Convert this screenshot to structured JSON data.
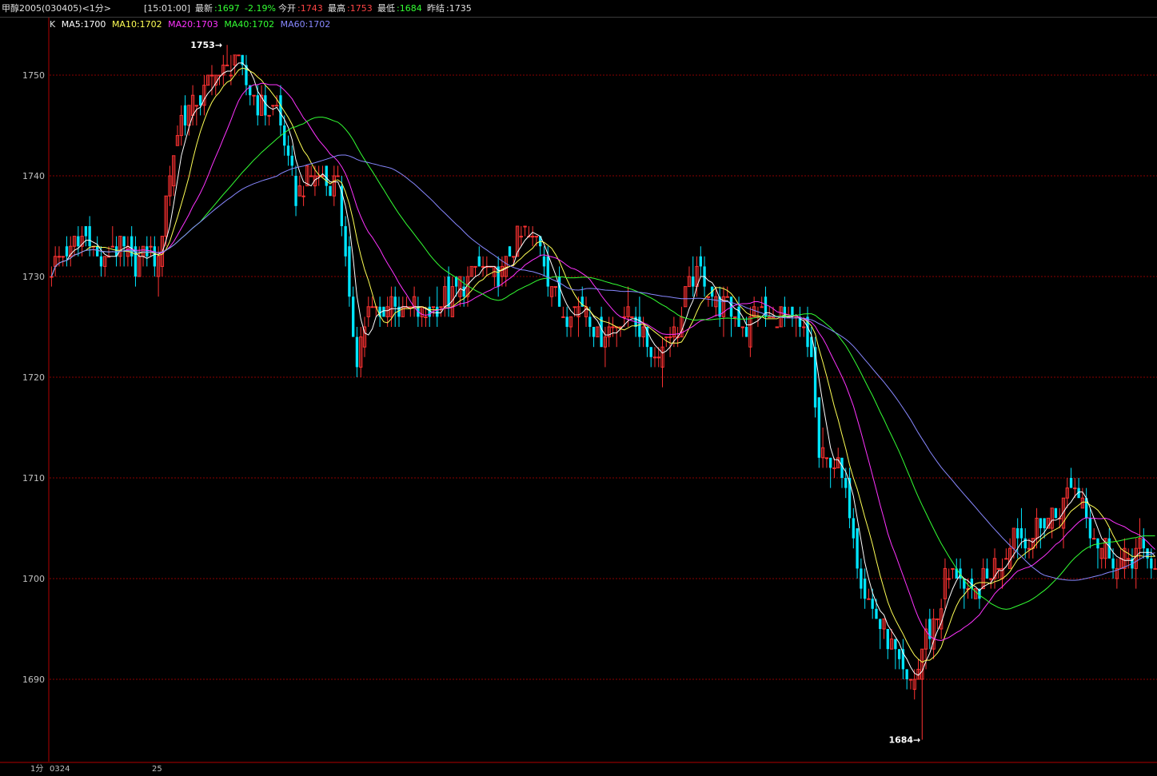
{
  "header": {
    "instrument": "甲醇2005(030405)<1分>",
    "time": "[15:01:00]",
    "latest_label": "最新",
    "latest_value": ":1697",
    "change_pct": "-2.19%",
    "open_label": "今开",
    "open_value": ":1743",
    "high_label": "最高",
    "high_value": ":1753",
    "low_label": "最低",
    "low_value": ":1684",
    "prev_close_label": "昨结",
    "prev_close_value": ":1735"
  },
  "legend": {
    "k": "K",
    "items": [
      {
        "text": "MA5:1700",
        "color": "#ffffff"
      },
      {
        "text": "MA10:1702",
        "color": "#ffff55"
      },
      {
        "text": "MA20:1703",
        "color": "#ff33ff"
      },
      {
        "text": "MA40:1702",
        "color": "#33ff33"
      },
      {
        "text": "MA60:1702",
        "color": "#8888ff"
      }
    ]
  },
  "footer": {
    "period": "1分",
    "date1": "0324",
    "date2": "25"
  },
  "colors": {
    "up": "#ff3232",
    "down": "#00e5ff",
    "axis": "#b00000",
    "grid": "#8b0000",
    "text": "#c0c0c0"
  },
  "chart_data": {
    "type": "candlestick",
    "ylim": [
      1683,
      1756
    ],
    "yticks": [
      1690,
      1700,
      1710,
      1720,
      1730,
      1740,
      1750
    ],
    "max_annotation": "1753→",
    "min_annotation": "1684→",
    "series": [
      {
        "name": "MA5",
        "color": "#ffffff",
        "closes_key": "ma5"
      },
      {
        "name": "MA10",
        "color": "#ffff55"
      },
      {
        "name": "MA20",
        "color": "#ff33ff"
      },
      {
        "name": "MA40",
        "color": "#33ff33"
      },
      {
        "name": "MA60",
        "color": "#8888ff"
      }
    ],
    "key_closes": [
      [
        0,
        1731
      ],
      [
        6,
        1733
      ],
      [
        10,
        1734
      ],
      [
        13,
        1731
      ],
      [
        16,
        1733
      ],
      [
        20,
        1732
      ],
      [
        22,
        1731
      ],
      [
        25,
        1733
      ],
      [
        28,
        1731
      ],
      [
        30,
        1738
      ],
      [
        34,
        1746
      ],
      [
        37,
        1747
      ],
      [
        40,
        1748
      ],
      [
        43,
        1751
      ],
      [
        45,
        1750
      ],
      [
        48,
        1752
      ],
      [
        50,
        1750
      ],
      [
        53,
        1748
      ],
      [
        56,
        1746
      ],
      [
        59,
        1747
      ],
      [
        61,
        1743
      ],
      [
        64,
        1738
      ],
      [
        67,
        1740
      ],
      [
        70,
        1740
      ],
      [
        73,
        1739
      ],
      [
        75,
        1740
      ],
      [
        78,
        1727
      ],
      [
        80,
        1722
      ],
      [
        83,
        1727
      ],
      [
        86,
        1726
      ],
      [
        89,
        1728
      ],
      [
        92,
        1726
      ],
      [
        95,
        1727
      ],
      [
        98,
        1726
      ],
      [
        101,
        1727
      ],
      [
        104,
        1728
      ],
      [
        107,
        1729
      ],
      [
        110,
        1730
      ],
      [
        113,
        1731
      ],
      [
        116,
        1730
      ],
      [
        119,
        1731
      ],
      [
        122,
        1734
      ],
      [
        125,
        1734
      ],
      [
        128,
        1733
      ],
      [
        131,
        1729
      ],
      [
        134,
        1726
      ],
      [
        137,
        1727
      ],
      [
        140,
        1727
      ],
      [
        143,
        1724
      ],
      [
        146,
        1725
      ],
      [
        149,
        1726
      ],
      [
        152,
        1726
      ],
      [
        155,
        1724
      ],
      [
        158,
        1722
      ],
      [
        161,
        1724
      ],
      [
        164,
        1725
      ],
      [
        167,
        1729
      ],
      [
        170,
        1730
      ],
      [
        173,
        1728
      ],
      [
        176,
        1727
      ],
      [
        179,
        1726
      ],
      [
        182,
        1725
      ],
      [
        185,
        1727
      ],
      [
        188,
        1726
      ],
      [
        191,
        1726
      ],
      [
        194,
        1725
      ],
      [
        196,
        1725
      ],
      [
        199,
        1722
      ],
      [
        201,
        1712
      ],
      [
        204,
        1712
      ],
      [
        207,
        1710
      ],
      [
        209,
        1707
      ],
      [
        212,
        1700
      ],
      [
        215,
        1697
      ],
      [
        218,
        1695
      ],
      [
        221,
        1692
      ],
      [
        224,
        1689
      ],
      [
        226,
        1690
      ],
      [
        229,
        1694
      ],
      [
        232,
        1696
      ],
      [
        234,
        1700
      ],
      [
        237,
        1701
      ],
      [
        240,
        1698
      ],
      [
        243,
        1699
      ],
      [
        246,
        1701
      ],
      [
        249,
        1702
      ],
      [
        252,
        1705
      ],
      [
        255,
        1703
      ],
      [
        258,
        1705
      ],
      [
        261,
        1706
      ],
      [
        264,
        1707
      ],
      [
        267,
        1709
      ],
      [
        270,
        1708
      ],
      [
        273,
        1704
      ],
      [
        276,
        1703
      ],
      [
        279,
        1701
      ],
      [
        282,
        1702
      ],
      [
        285,
        1703
      ],
      [
        287,
        1702
      ],
      [
        289,
        1701
      ]
    ],
    "highs": [
      [
        46,
        1753
      ]
    ],
    "lows": [
      [
        228,
        1684
      ]
    ]
  }
}
